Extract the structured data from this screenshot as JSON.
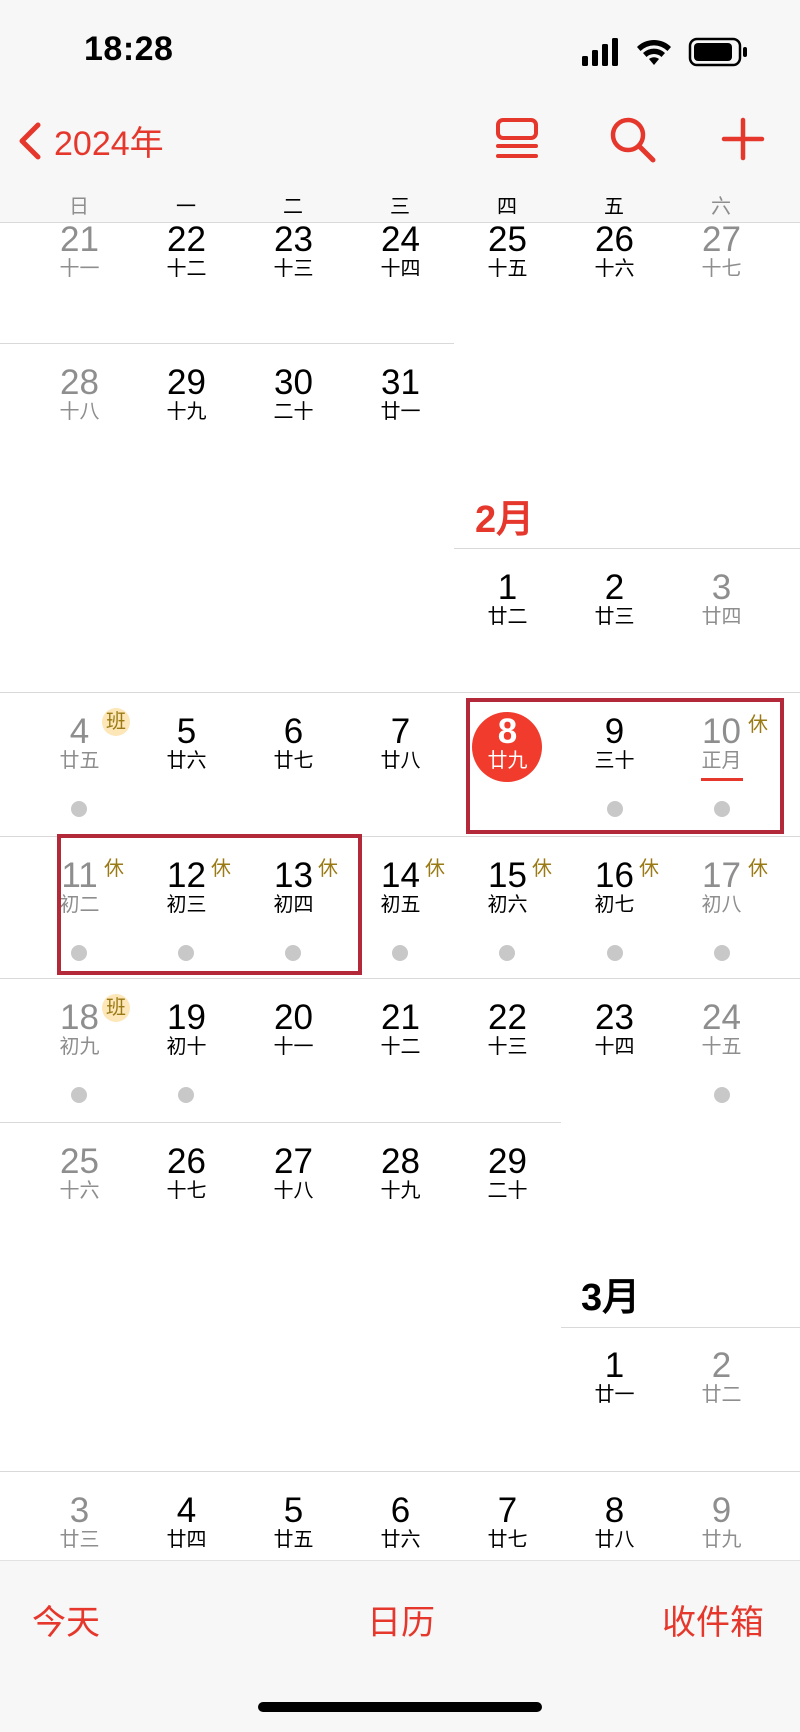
{
  "status": {
    "time": "18:28"
  },
  "nav": {
    "back_label": "2024年"
  },
  "weekdays": [
    "日",
    "一",
    "二",
    "三",
    "四",
    "五",
    "六"
  ],
  "months": {
    "feb": "2月",
    "mar": "3月"
  },
  "days": {
    "jan21": {
      "num": "21",
      "lunar": "十一"
    },
    "jan22": {
      "num": "22",
      "lunar": "十二"
    },
    "jan23": {
      "num": "23",
      "lunar": "十三"
    },
    "jan24": {
      "num": "24",
      "lunar": "十四"
    },
    "jan25": {
      "num": "25",
      "lunar": "十五"
    },
    "jan26": {
      "num": "26",
      "lunar": "十六"
    },
    "jan27": {
      "num": "27",
      "lunar": "十七"
    },
    "jan28": {
      "num": "28",
      "lunar": "十八"
    },
    "jan29": {
      "num": "29",
      "lunar": "十九"
    },
    "jan30": {
      "num": "30",
      "lunar": "二十"
    },
    "jan31": {
      "num": "31",
      "lunar": "廿一"
    },
    "feb1": {
      "num": "1",
      "lunar": "廿二"
    },
    "feb2": {
      "num": "2",
      "lunar": "廿三"
    },
    "feb3": {
      "num": "3",
      "lunar": "廿四"
    },
    "feb4": {
      "num": "4",
      "lunar": "廿五"
    },
    "feb5": {
      "num": "5",
      "lunar": "廿六"
    },
    "feb6": {
      "num": "6",
      "lunar": "廿七"
    },
    "feb7": {
      "num": "7",
      "lunar": "廿八"
    },
    "feb8": {
      "num": "8",
      "lunar": "廿九"
    },
    "feb9": {
      "num": "9",
      "lunar": "三十"
    },
    "feb10": {
      "num": "10",
      "lunar": "正月"
    },
    "feb11": {
      "num": "11",
      "lunar": "初二"
    },
    "feb12": {
      "num": "12",
      "lunar": "初三"
    },
    "feb13": {
      "num": "13",
      "lunar": "初四"
    },
    "feb14": {
      "num": "14",
      "lunar": "初五"
    },
    "feb15": {
      "num": "15",
      "lunar": "初六"
    },
    "feb16": {
      "num": "16",
      "lunar": "初七"
    },
    "feb17": {
      "num": "17",
      "lunar": "初八"
    },
    "feb18": {
      "num": "18",
      "lunar": "初九"
    },
    "feb19": {
      "num": "19",
      "lunar": "初十"
    },
    "feb20": {
      "num": "20",
      "lunar": "十一"
    },
    "feb21": {
      "num": "21",
      "lunar": "十二"
    },
    "feb22": {
      "num": "22",
      "lunar": "十三"
    },
    "feb23": {
      "num": "23",
      "lunar": "十四"
    },
    "feb24": {
      "num": "24",
      "lunar": "十五"
    },
    "feb25": {
      "num": "25",
      "lunar": "十六"
    },
    "feb26": {
      "num": "26",
      "lunar": "十七"
    },
    "feb27": {
      "num": "27",
      "lunar": "十八"
    },
    "feb28": {
      "num": "28",
      "lunar": "十九"
    },
    "feb29": {
      "num": "29",
      "lunar": "二十"
    },
    "mar1": {
      "num": "1",
      "lunar": "廿一"
    },
    "mar2": {
      "num": "2",
      "lunar": "廿二"
    },
    "mar3": {
      "num": "3",
      "lunar": "廿三"
    },
    "mar4": {
      "num": "4",
      "lunar": "廿四"
    },
    "mar5": {
      "num": "5",
      "lunar": "廿五"
    },
    "mar6": {
      "num": "6",
      "lunar": "廿六"
    },
    "mar7": {
      "num": "7",
      "lunar": "廿七"
    },
    "mar8": {
      "num": "8",
      "lunar": "廿八"
    },
    "mar9": {
      "num": "9",
      "lunar": "廿九"
    }
  },
  "badges": {
    "work": "班",
    "rest": "休"
  },
  "tabs": {
    "today": "今天",
    "calendars": "日历",
    "inbox": "收件箱"
  },
  "colors": {
    "accent": "#e5372c",
    "today_circle": "#f03b2d",
    "holiday_badge": "#9a7a15",
    "highlight_box": "#b3293a"
  }
}
